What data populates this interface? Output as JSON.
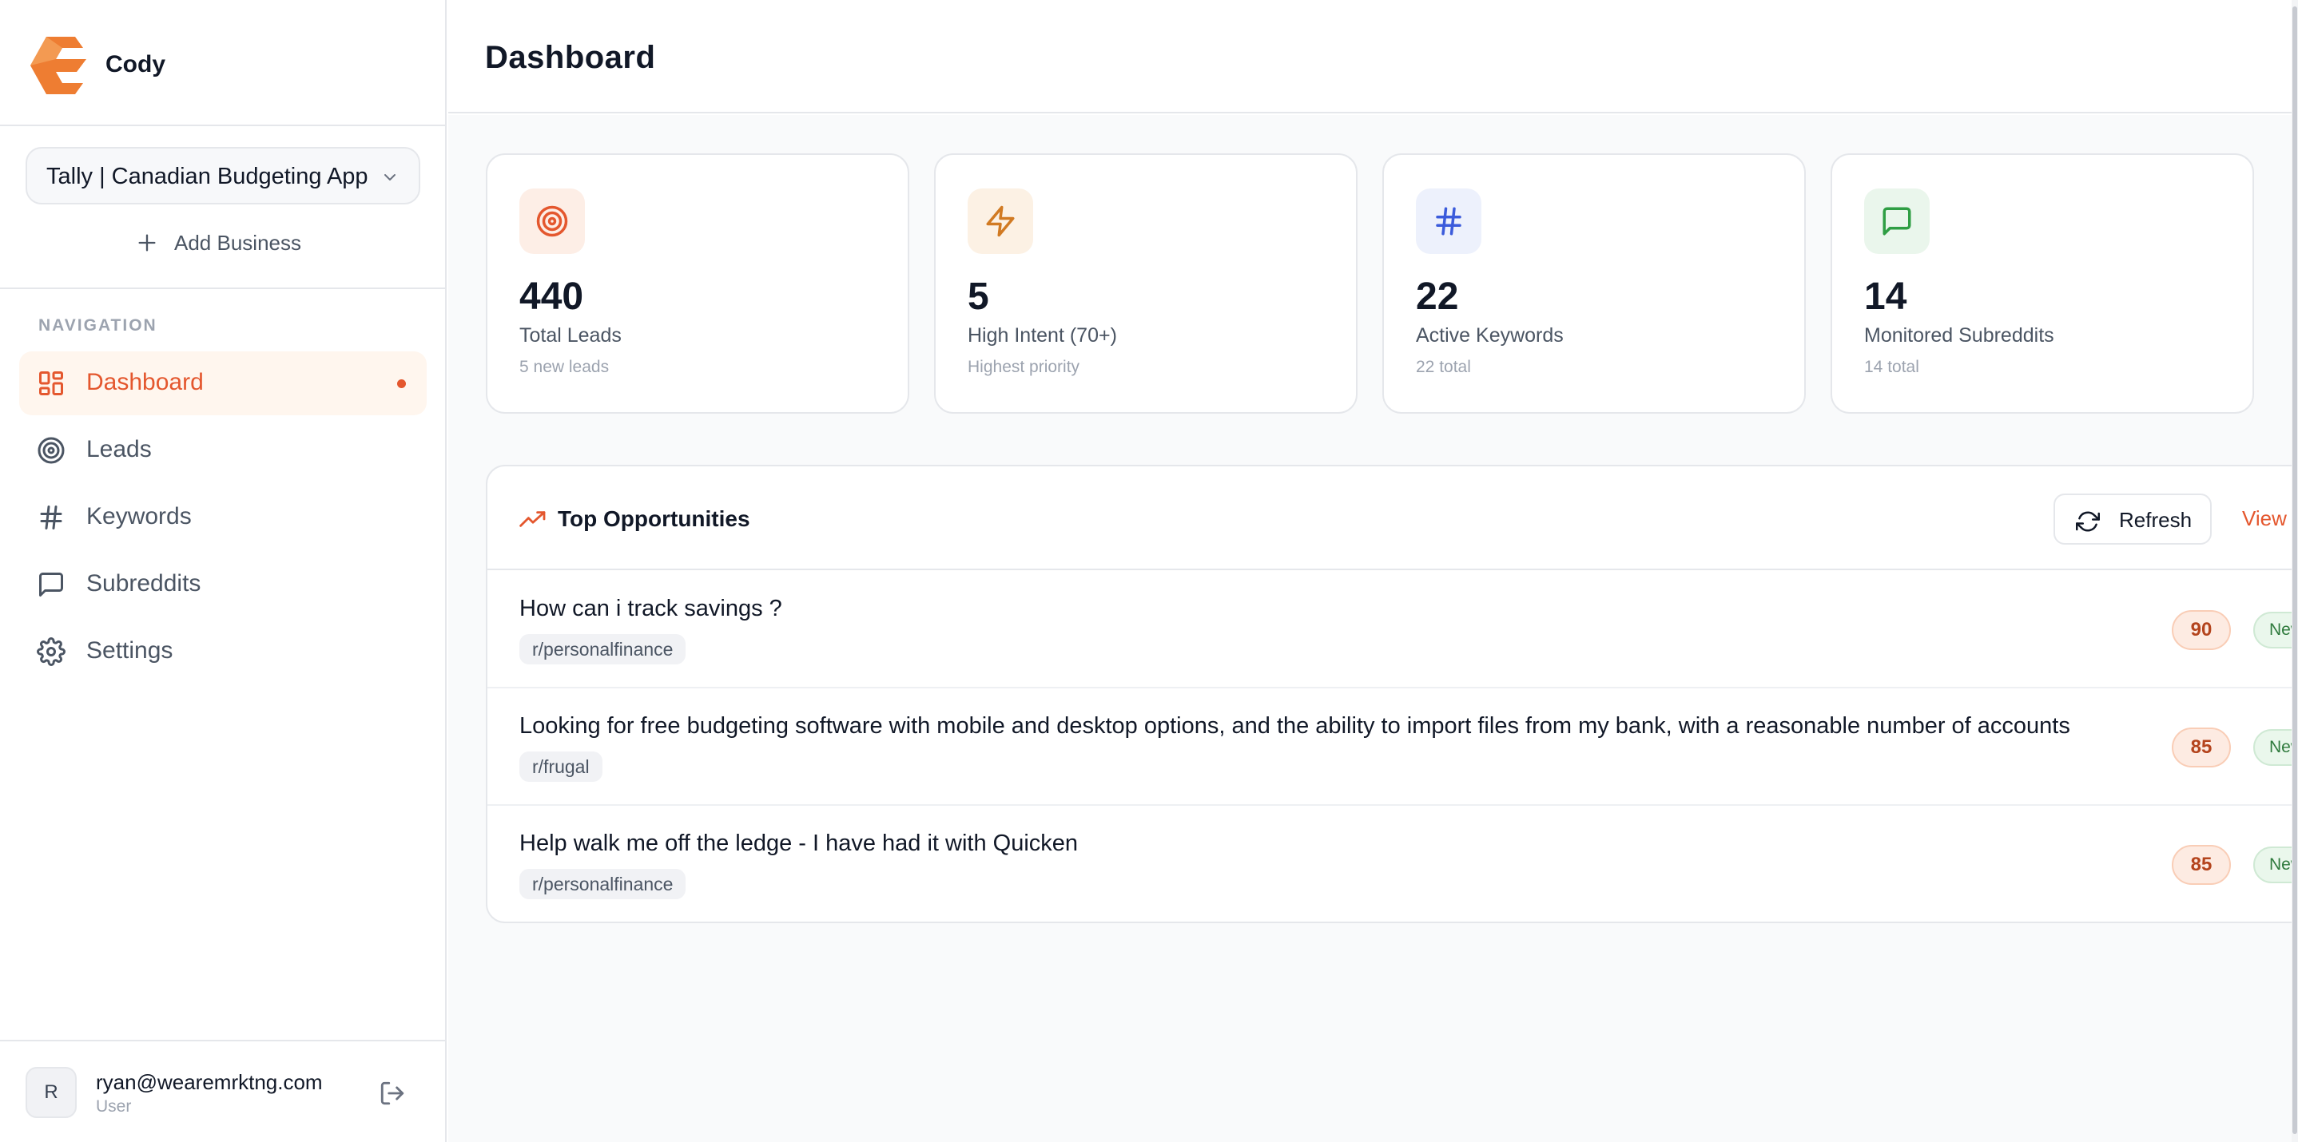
{
  "brand": {
    "name": "Cody",
    "accent": "#e4572e"
  },
  "business": {
    "selected": "Tally | Canadian Budgeting App",
    "add_label": "Add Business"
  },
  "nav": {
    "heading": "NAVIGATION",
    "items": [
      {
        "label": "Dashboard",
        "icon": "dashboard-icon",
        "active": true
      },
      {
        "label": "Leads",
        "icon": "target-icon",
        "active": false
      },
      {
        "label": "Keywords",
        "icon": "hash-icon",
        "active": false
      },
      {
        "label": "Subreddits",
        "icon": "message-icon",
        "active": false
      },
      {
        "label": "Settings",
        "icon": "gear-icon",
        "active": false
      }
    ]
  },
  "user": {
    "initial": "R",
    "email": "ryan@wearemrktng.com",
    "role": "User"
  },
  "page": {
    "title": "Dashboard"
  },
  "stats": [
    {
      "value": "440",
      "label": "Total Leads",
      "sub": "5 new leads",
      "icon": "target-icon",
      "color": "#e4572e",
      "bg": "#fdeee6"
    },
    {
      "value": "5",
      "label": "High Intent (70+)",
      "sub": "Highest priority",
      "icon": "zap-icon",
      "color": "#d17a22",
      "bg": "#fcf1e4"
    },
    {
      "value": "22",
      "label": "Active Keywords",
      "sub": "22 total",
      "icon": "hash-icon",
      "color": "#3b5bdb",
      "bg": "#edf1fc"
    },
    {
      "value": "14",
      "label": "Monitored Subreddits",
      "sub": "14 total",
      "icon": "message-icon",
      "color": "#2f9e44",
      "bg": "#eaf6ec"
    }
  ],
  "opportunities": {
    "title": "Top Opportunities",
    "refresh_label": "Refresh",
    "view_label": "View",
    "rows": [
      {
        "title": "How can i track savings ?",
        "subreddit": "r/personalfinance",
        "score": "90",
        "status": "New"
      },
      {
        "title": "Looking for free budgeting software with mobile and desktop options, and the ability to import files from my bank, with a reasonable number of accounts",
        "subreddit": "r/frugal",
        "score": "85",
        "status": "New"
      },
      {
        "title": "Help walk me off the ledge - I have had it with Quicken",
        "subreddit": "r/personalfinance",
        "score": "85",
        "status": "New"
      }
    ]
  }
}
